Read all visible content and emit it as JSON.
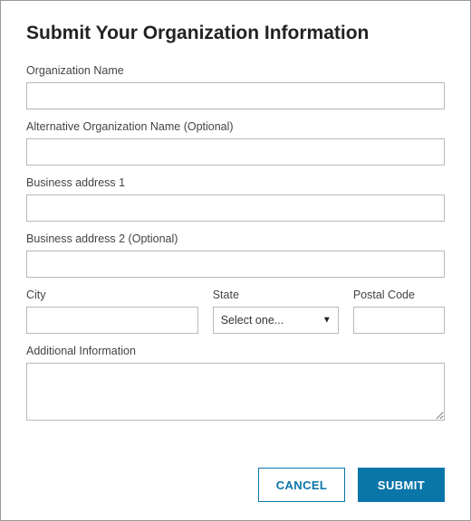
{
  "title": "Submit Your Organization Information",
  "fields": {
    "org_name": {
      "label": "Organization Name",
      "value": ""
    },
    "alt_org_name": {
      "label": "Alternative Organization Name  (Optional)",
      "value": ""
    },
    "addr1": {
      "label": "Business address 1",
      "value": ""
    },
    "addr2": {
      "label": "Business address 2  (Optional)",
      "value": ""
    },
    "city": {
      "label": "City",
      "value": ""
    },
    "state": {
      "label": "State",
      "selected": "Select one..."
    },
    "postal": {
      "label": "Postal Code",
      "value": ""
    },
    "additional_info": {
      "label": "Additional Information",
      "value": ""
    }
  },
  "buttons": {
    "cancel": "CANCEL",
    "submit": "SUBMIT"
  },
  "colors": {
    "accent": "#0a75a8"
  }
}
